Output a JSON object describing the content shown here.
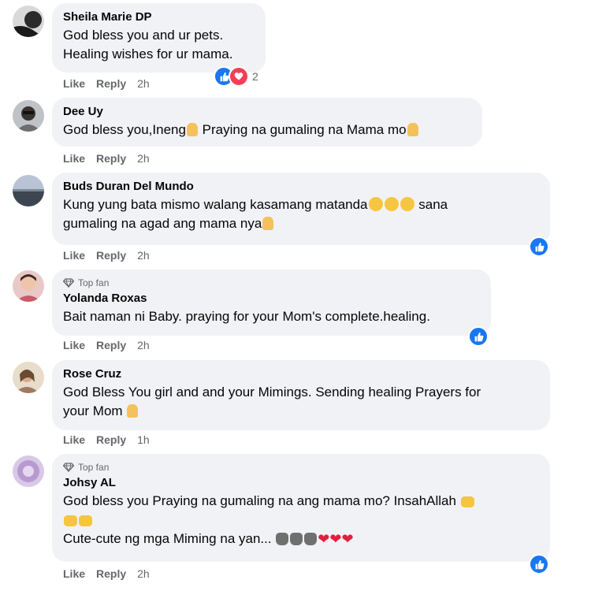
{
  "comments": [
    {
      "author": "Sheila Marie DP",
      "lines": [
        "God bless you and ur pets.",
        "Healing wishes for ur mama."
      ],
      "like": "Like",
      "reply": "Reply",
      "time": "2h",
      "reaction_count": "2"
    },
    {
      "author": "Dee Uy",
      "text_a": "God bless you,Ineng",
      "text_b": " Praying na gumaling na Mama mo",
      "like": "Like",
      "reply": "Reply",
      "time": "2h"
    },
    {
      "author": "Buds Duran Del Mundo",
      "line1_a": "Kung yung bata mismo walang kasamang matanda",
      "line1_b": " sana",
      "line2": "gumaling na agad ang mama nya",
      "like": "Like",
      "reply": "Reply",
      "time": "2h"
    },
    {
      "badge": "Top fan",
      "author": "Yolanda Roxas",
      "text": "Bait naman ni Baby. praying for your Mom's complete.healing.",
      "like": "Like",
      "reply": "Reply",
      "time": "2h"
    },
    {
      "author": "Rose Cruz",
      "line1": "God Bless You girl and and your Mimings. Sending healing Prayers for",
      "line2": "your Mom ",
      "like": "Like",
      "reply": "Reply",
      "time": "1h"
    },
    {
      "badge": "Top fan",
      "author": "Johsy AL",
      "line1": "God bless you Praying na gumaling na ang mama mo? InsahAllah ",
      "line3": "Cute-cute ng mga Miming na yan... ",
      "like": "Like",
      "reply": "Reply",
      "time": "2h"
    }
  ],
  "colors": {
    "bubble": "#f0f2f5",
    "like_blue": "#1877f2",
    "love_red": "#f33e58",
    "meta_gray": "#65676b"
  },
  "icons": [
    "like-reaction-icon",
    "love-reaction-icon",
    "top-fan-diamond-icon",
    "folded-hands-emoji",
    "crying-face-emoji",
    "raising-hands-emoji",
    "cat-emoji",
    "red-heart-emoji"
  ]
}
